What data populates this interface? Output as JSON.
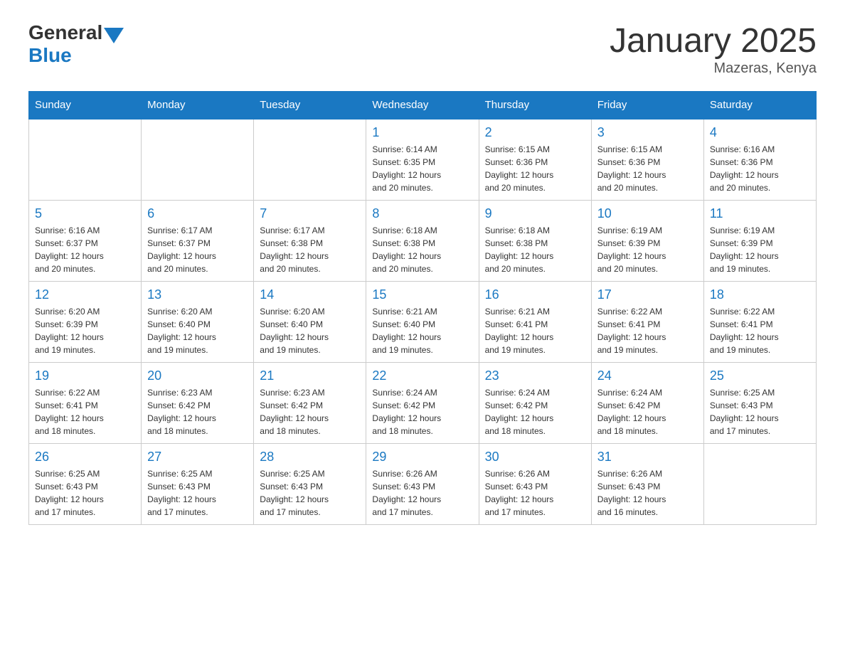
{
  "header": {
    "logo_general": "General",
    "logo_blue": "Blue",
    "title": "January 2025",
    "subtitle": "Mazeras, Kenya"
  },
  "weekdays": [
    "Sunday",
    "Monday",
    "Tuesday",
    "Wednesday",
    "Thursday",
    "Friday",
    "Saturday"
  ],
  "weeks": [
    [
      {
        "day": "",
        "info": ""
      },
      {
        "day": "",
        "info": ""
      },
      {
        "day": "",
        "info": ""
      },
      {
        "day": "1",
        "info": "Sunrise: 6:14 AM\nSunset: 6:35 PM\nDaylight: 12 hours\nand 20 minutes."
      },
      {
        "day": "2",
        "info": "Sunrise: 6:15 AM\nSunset: 6:36 PM\nDaylight: 12 hours\nand 20 minutes."
      },
      {
        "day": "3",
        "info": "Sunrise: 6:15 AM\nSunset: 6:36 PM\nDaylight: 12 hours\nand 20 minutes."
      },
      {
        "day": "4",
        "info": "Sunrise: 6:16 AM\nSunset: 6:36 PM\nDaylight: 12 hours\nand 20 minutes."
      }
    ],
    [
      {
        "day": "5",
        "info": "Sunrise: 6:16 AM\nSunset: 6:37 PM\nDaylight: 12 hours\nand 20 minutes."
      },
      {
        "day": "6",
        "info": "Sunrise: 6:17 AM\nSunset: 6:37 PM\nDaylight: 12 hours\nand 20 minutes."
      },
      {
        "day": "7",
        "info": "Sunrise: 6:17 AM\nSunset: 6:38 PM\nDaylight: 12 hours\nand 20 minutes."
      },
      {
        "day": "8",
        "info": "Sunrise: 6:18 AM\nSunset: 6:38 PM\nDaylight: 12 hours\nand 20 minutes."
      },
      {
        "day": "9",
        "info": "Sunrise: 6:18 AM\nSunset: 6:38 PM\nDaylight: 12 hours\nand 20 minutes."
      },
      {
        "day": "10",
        "info": "Sunrise: 6:19 AM\nSunset: 6:39 PM\nDaylight: 12 hours\nand 20 minutes."
      },
      {
        "day": "11",
        "info": "Sunrise: 6:19 AM\nSunset: 6:39 PM\nDaylight: 12 hours\nand 19 minutes."
      }
    ],
    [
      {
        "day": "12",
        "info": "Sunrise: 6:20 AM\nSunset: 6:39 PM\nDaylight: 12 hours\nand 19 minutes."
      },
      {
        "day": "13",
        "info": "Sunrise: 6:20 AM\nSunset: 6:40 PM\nDaylight: 12 hours\nand 19 minutes."
      },
      {
        "day": "14",
        "info": "Sunrise: 6:20 AM\nSunset: 6:40 PM\nDaylight: 12 hours\nand 19 minutes."
      },
      {
        "day": "15",
        "info": "Sunrise: 6:21 AM\nSunset: 6:40 PM\nDaylight: 12 hours\nand 19 minutes."
      },
      {
        "day": "16",
        "info": "Sunrise: 6:21 AM\nSunset: 6:41 PM\nDaylight: 12 hours\nand 19 minutes."
      },
      {
        "day": "17",
        "info": "Sunrise: 6:22 AM\nSunset: 6:41 PM\nDaylight: 12 hours\nand 19 minutes."
      },
      {
        "day": "18",
        "info": "Sunrise: 6:22 AM\nSunset: 6:41 PM\nDaylight: 12 hours\nand 19 minutes."
      }
    ],
    [
      {
        "day": "19",
        "info": "Sunrise: 6:22 AM\nSunset: 6:41 PM\nDaylight: 12 hours\nand 18 minutes."
      },
      {
        "day": "20",
        "info": "Sunrise: 6:23 AM\nSunset: 6:42 PM\nDaylight: 12 hours\nand 18 minutes."
      },
      {
        "day": "21",
        "info": "Sunrise: 6:23 AM\nSunset: 6:42 PM\nDaylight: 12 hours\nand 18 minutes."
      },
      {
        "day": "22",
        "info": "Sunrise: 6:24 AM\nSunset: 6:42 PM\nDaylight: 12 hours\nand 18 minutes."
      },
      {
        "day": "23",
        "info": "Sunrise: 6:24 AM\nSunset: 6:42 PM\nDaylight: 12 hours\nand 18 minutes."
      },
      {
        "day": "24",
        "info": "Sunrise: 6:24 AM\nSunset: 6:42 PM\nDaylight: 12 hours\nand 18 minutes."
      },
      {
        "day": "25",
        "info": "Sunrise: 6:25 AM\nSunset: 6:43 PM\nDaylight: 12 hours\nand 17 minutes."
      }
    ],
    [
      {
        "day": "26",
        "info": "Sunrise: 6:25 AM\nSunset: 6:43 PM\nDaylight: 12 hours\nand 17 minutes."
      },
      {
        "day": "27",
        "info": "Sunrise: 6:25 AM\nSunset: 6:43 PM\nDaylight: 12 hours\nand 17 minutes."
      },
      {
        "day": "28",
        "info": "Sunrise: 6:25 AM\nSunset: 6:43 PM\nDaylight: 12 hours\nand 17 minutes."
      },
      {
        "day": "29",
        "info": "Sunrise: 6:26 AM\nSunset: 6:43 PM\nDaylight: 12 hours\nand 17 minutes."
      },
      {
        "day": "30",
        "info": "Sunrise: 6:26 AM\nSunset: 6:43 PM\nDaylight: 12 hours\nand 17 minutes."
      },
      {
        "day": "31",
        "info": "Sunrise: 6:26 AM\nSunset: 6:43 PM\nDaylight: 12 hours\nand 16 minutes."
      },
      {
        "day": "",
        "info": ""
      }
    ]
  ]
}
